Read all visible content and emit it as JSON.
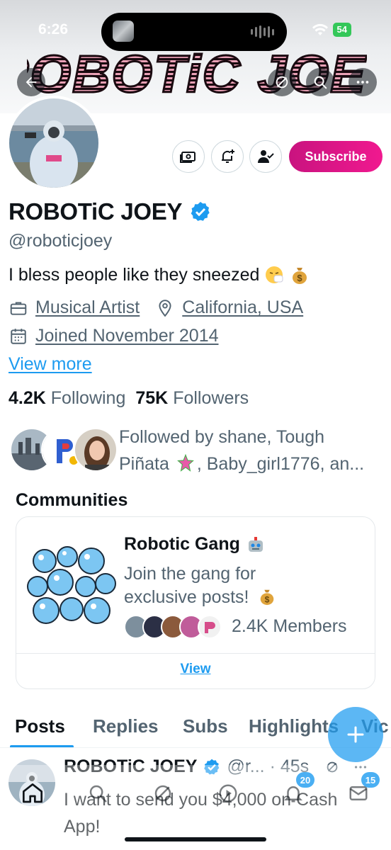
{
  "status_bar": {
    "time": "6:26",
    "battery": "54"
  },
  "banner": {
    "title_art": "ROBOTiC JOEY"
  },
  "header_buttons": {
    "back": "back-arrow-icon",
    "grok": "grok-icon",
    "search": "search-icon",
    "more": "more-icon"
  },
  "profile": {
    "display_name": "ROBOTiC JOEY",
    "handle": "@roboticjoey",
    "bio": "I bless people like they sneezed",
    "category": "Musical Artist",
    "location": "California, USA",
    "joined": "Joined November 2014",
    "view_more": "View more",
    "following_count": "4.2K",
    "following_label": "Following",
    "followers_count": "75K",
    "followers_label": "Followers",
    "followed_by_line1": "Followed by shane, Tough",
    "followed_by_line2a": "Piñata",
    "followed_by_line2b": ", Baby_girl1776, an...",
    "subscribe_label": "Subscribe"
  },
  "communities": {
    "title": "Communities",
    "name": "Robotic Gang",
    "description": "Join the gang for exclusive posts!",
    "members": "2.4K Members",
    "view_label": "View"
  },
  "tabs": [
    {
      "label": "Posts",
      "active": true
    },
    {
      "label": "Replies",
      "active": false
    },
    {
      "label": "Subs",
      "active": false
    },
    {
      "label": "Highlights",
      "active": false
    },
    {
      "label": "Vic",
      "active": false
    }
  ],
  "post": {
    "author": "ROBOTiC JOEY",
    "handle_time": "@r... · 45s",
    "text": "I want to send you $4,000 on Cash App!"
  },
  "bottom_nav": {
    "items": [
      "home-icon",
      "search-icon",
      "grok-icon",
      "spaces-icon",
      "notifications-icon",
      "messages-icon"
    ],
    "notifications_badge": "20",
    "messages_badge": "15"
  },
  "colors": {
    "accent": "#1d9bf0",
    "subscribe": "#e0158a",
    "text_secondary": "#536471"
  }
}
